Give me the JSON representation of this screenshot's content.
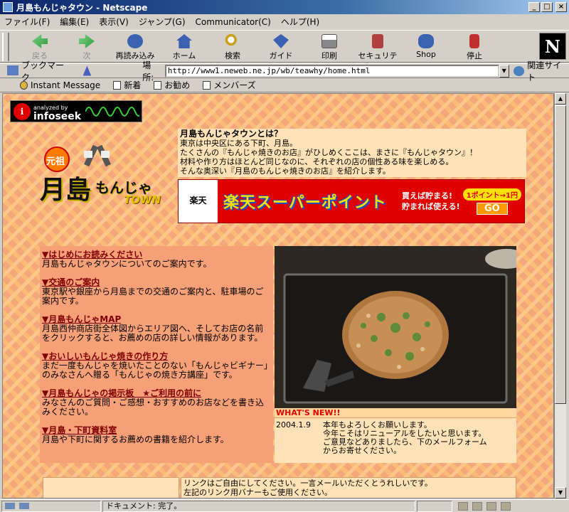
{
  "window": {
    "title": "月島もんじゃタウン - Netscape",
    "buttons": [
      "_",
      "□",
      "×"
    ]
  },
  "menu": [
    "ファイル(F)",
    "編集(E)",
    "表示(V)",
    "ジャンプ(G)",
    "Communicator(C)",
    "ヘルプ(H)"
  ],
  "toolbar": {
    "buttons": [
      {
        "label": "戻る",
        "icon": "back-arrow-icon",
        "color": "#2f9a3a"
      },
      {
        "label": "次",
        "icon": "forward-arrow-icon",
        "color": "#2f9a3a"
      },
      {
        "label": "再読み込み",
        "icon": "reload-icon",
        "color": "#3a62b0"
      },
      {
        "label": "ホーム",
        "icon": "home-icon",
        "color": "#3a62b0"
      },
      {
        "label": "検索",
        "icon": "search-icon",
        "color": "#c8a020"
      },
      {
        "label": "ガイド",
        "icon": "guide-icon",
        "color": "#3a62b0"
      },
      {
        "label": "印刷",
        "icon": "print-icon",
        "color": "#777777"
      },
      {
        "label": "セキュリティ",
        "icon": "lock-icon",
        "color": "#b04040"
      },
      {
        "label": "Shop",
        "icon": "shop-icon",
        "color": "#3a62b0"
      },
      {
        "label": "停止",
        "icon": "stop-icon",
        "color": "#c03030"
      }
    ],
    "logo": "N"
  },
  "location": {
    "bookmark_label": "ブックマーク",
    "location_label": "場所:",
    "url": "http://www1.neweb.ne.jp/wb/teawhy/home.html",
    "related_label": "関連サイト"
  },
  "personal_bar": [
    "Instant Message",
    "新着",
    "お勧め",
    "メンバーズ"
  ],
  "page": {
    "infoseek": {
      "top": "analyzed by",
      "brand": "infoseek"
    },
    "logo": {
      "badge": "元祖",
      "main": "月島",
      "mid": "もんじゃ",
      "sub": "TOWN"
    },
    "intro": {
      "heading": "月島もんじゃタウンとは？",
      "lines": [
        "東京は中央区にある下町、月島。",
        "たくさんの『もんじゃ焼きのお店』がひしめくここは、まさに『もんじゃタウン』！",
        "材料や作り方はほとんど同じなのに、それぞれの店の個性ある味を楽しめる。",
        "そんな奥深い『月島のもんじゃ焼きのお店』を紹介します。"
      ]
    },
    "banner": {
      "logo": "楽天",
      "title": "楽天スーパーポイント",
      "sub1": "買えば貯まる!",
      "sub2": "貯まれば使える!",
      "point": "1ポイント→1円",
      "go": "GO"
    },
    "nav": [
      {
        "link": "▼はじめにお読みください",
        "desc": "月島もんじゃタウンについてのご案内です。"
      },
      {
        "link": "▼交通のご案内",
        "desc": "東京駅や銀座から月島までの交通のご案内と、駐車場のご案内です。"
      },
      {
        "link": "▼月島もんじゃMAP",
        "desc": "月島西仲商店街全体図からエリア図へ、そしてお店の名前をクリックすると、お薦めの店の詳しい情報があります。"
      },
      {
        "link": "▼おいしいもんじゃ焼きの作り方",
        "desc": "まだ一度もんじゃを焼いたことのない「もんじゃビギナー」のみなさんへ贈る「もんじゃの焼き方講座」です。"
      },
      {
        "link": "▼月島もんじゃの掲示板　★ご利用の前に",
        "desc": "みなさんのご質問・ご感想・おすすめのお店などを書き込みください。"
      },
      {
        "link": "▼月島・下町資料室",
        "desc": "月島や下町に関するお薦めの書籍を紹介します。"
      }
    ],
    "news": {
      "title": "WHAT'S NEW!!",
      "date": "2004.1.9",
      "lines": [
        "本年もよろしくお願いします。",
        "今年こそはリニューアルをしたいと思います。",
        "ご意見などありましたら、下のメールフォーム",
        "からお寄せください。"
      ]
    },
    "footer": [
      "リンクはご自由にしてください。一言メールいただくとうれしいです。",
      "左記のリンク用バナーもご使用ください。"
    ]
  },
  "status": {
    "text": "ドキュメント: 完了。"
  }
}
